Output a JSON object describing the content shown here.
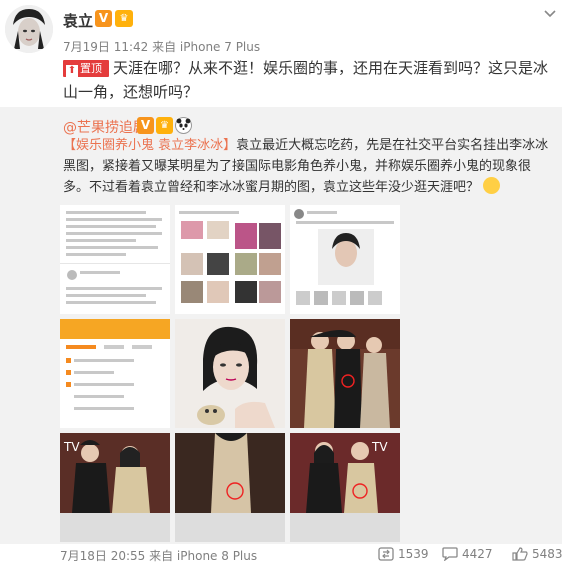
{
  "post": {
    "username": "袁立",
    "verify_badge": "V",
    "timestamp": "7月19日 11:42 来自 iPhone 7 Plus",
    "pinned_label": "置顶",
    "text": "天涯在哪？从来不逛！娱乐圈的事，还用在天涯看到吗？这只是冰山一角，还想听吗？"
  },
  "repost": {
    "author": "@芒果捞追剧",
    "hashtag_1": "【娱乐圈养小鬼 袁立李冰冰】",
    "text": "袁立最近大概忘吃药，先是在社交平台实名挂出李冰冰黑图，紧接着又曝某明星为了接国际电影角色养小鬼，并称娱乐圈养小鬼的现象很多。不过看着袁立曾经和李冰冰蜜月期的图，袁立这些年没少逛天涯吧？",
    "images": [
      "screenshot-1",
      "screenshot-2",
      "screenshot-3",
      "screenshot-4",
      "portrait",
      "event-1",
      "event-2",
      "event-3",
      "event-4"
    ],
    "footer": {
      "timestamp": "7月18日 20:55 来自 iPhone 8 Plus",
      "reposts": "1539",
      "comments": "4427",
      "likes": "5483"
    }
  },
  "colors": {
    "accent": "#eb7350",
    "pin": "#e43c3c",
    "muted": "#808080",
    "repost_bg": "#f2f2f2"
  }
}
